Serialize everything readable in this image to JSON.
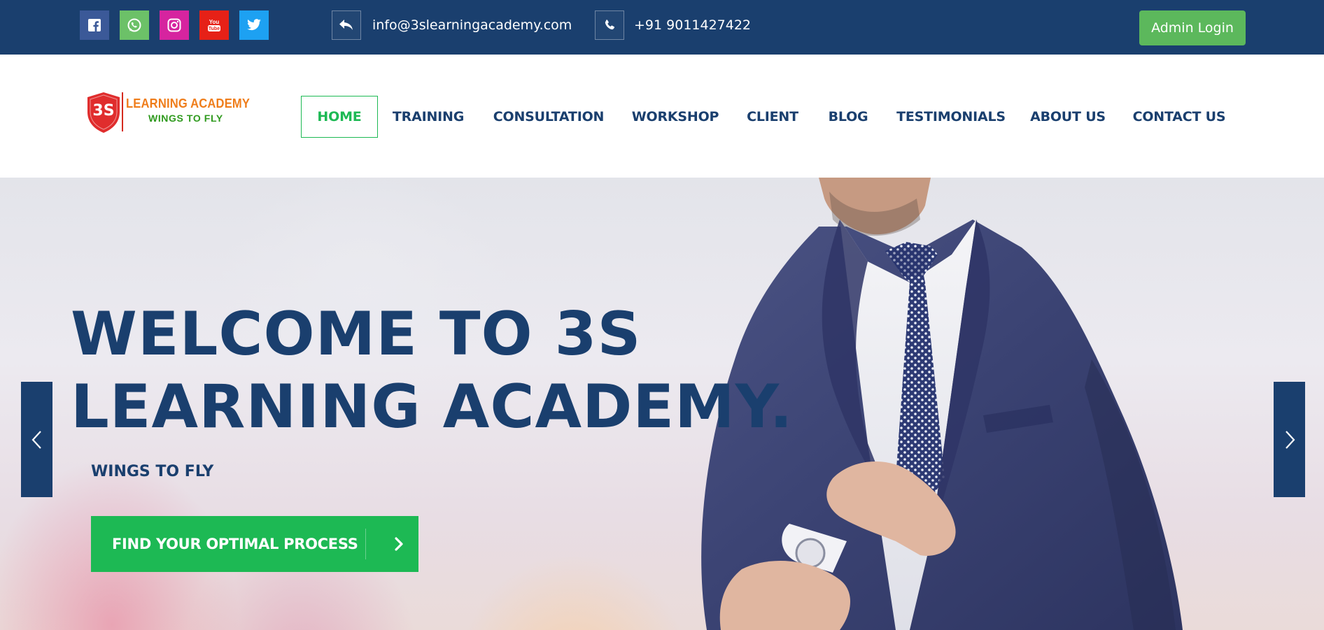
{
  "topbar": {
    "social": [
      {
        "name": "facebook-icon",
        "color": "#3b5998"
      },
      {
        "name": "whatsapp-icon",
        "color": "#6cc168"
      },
      {
        "name": "instagram-icon",
        "color": "#d6249f"
      },
      {
        "name": "youtube-icon",
        "color": "#e62117"
      },
      {
        "name": "twitter-icon",
        "color": "#1da1f2"
      }
    ],
    "email": "info@3slearningacademy.com",
    "phone": "+91 9011427422",
    "admin_login": "Admin Login"
  },
  "header": {
    "logo": {
      "badge": "3S",
      "line1": "LEARNING ACADEMY",
      "line2": "WINGS TO FLY"
    },
    "nav": [
      {
        "label": "HOME",
        "active": true
      },
      {
        "label": "TRAINING"
      },
      {
        "label": "CONSULTATION"
      },
      {
        "label": "WORKSHOP"
      },
      {
        "label": "CLIENT"
      },
      {
        "label": "BLOG"
      },
      {
        "label": "TESTIMONIALS"
      },
      {
        "label": "ABOUT US"
      },
      {
        "label": "CONTACT US"
      }
    ]
  },
  "hero": {
    "title_line1": "WELCOME TO 3S",
    "title_line2": "LEARNING ACADEMY.",
    "subtitle": "WINGS TO FLY",
    "cta_label": "FIND YOUR OPTIMAL PROCESS"
  },
  "colors": {
    "primary_navy": "#1a3f6e",
    "accent_green": "#1db954",
    "admin_green": "#5cb85c",
    "logo_red": "#e02d2d",
    "logo_orange": "#ef7d1a",
    "logo_green": "#2f9a1e"
  }
}
